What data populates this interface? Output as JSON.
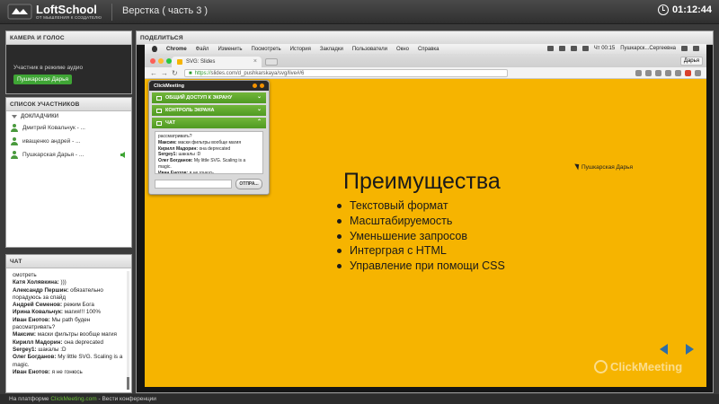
{
  "app": {
    "logo_name": "LoftSchool",
    "logo_tagline": "ОТ МЫШЛЕНИЯ К СОЗДАТЕЛЮ",
    "meeting_title": "Верстка ( часть 3 )",
    "timer": "01:12:44"
  },
  "camera_panel": {
    "title": "КАМЕРА И ГОЛОС",
    "audio_note": "Участник в режиме аудио",
    "speaker_name": "Пушкарская Дарья"
  },
  "users_panel": {
    "title": "СПИСОК УЧАСТНИКОВ",
    "group_label": "ДОКЛАДЧИКИ",
    "users": [
      {
        "name": "Дмитрий Ковальчук - ..."
      },
      {
        "name": "иващенко андрей - ..."
      },
      {
        "name": "Пушкарская Дарья - ..."
      }
    ]
  },
  "chat_panel": {
    "title": "ЧАТ",
    "messages": [
      {
        "author": "",
        "text": "смотреть"
      },
      {
        "author": "Катя Холявкина:",
        "text": ")))"
      },
      {
        "author": "Александр Першин:",
        "text": "обязательно порадуюсь за спайд"
      },
      {
        "author": "Андрей Семенов:",
        "text": "режим Бога"
      },
      {
        "author": "Ирина Ковальчук:",
        "text": "магия!!! 100%"
      },
      {
        "author": "Иван Енотов:",
        "text": "Мы path буден рассматривать?"
      },
      {
        "author": "Максим:",
        "text": "маски фильтры вообще магия"
      },
      {
        "author": "Кирилл Мадорин:",
        "text": "она deprecated"
      },
      {
        "author": "Sergey1:",
        "text": "шакалы :D"
      },
      {
        "author": "Олег Богданов:",
        "text": "My little SVG. Scaling is a magic."
      },
      {
        "author": "Иван Енотов:",
        "text": "я не гонюсь"
      }
    ]
  },
  "share_panel": {
    "title": "ПОДЕЛИТЬСЯ"
  },
  "mac_menu": {
    "items": [
      "Chrome",
      "Файл",
      "Изменить",
      "Посмотреть",
      "История",
      "Закладки",
      "Пользователи",
      "Окно",
      "Справка"
    ],
    "clock": "Чт 00:15",
    "user": "Пушкарск...Сергеевна"
  },
  "browser": {
    "tab_title": "SVG: Slides",
    "url_scheme": "https://",
    "url_rest": "slides.com/d_pushkarskaya/svg/live#/6",
    "user_button": "Дарья"
  },
  "slide": {
    "title": "Преимущества",
    "bullets": [
      "Текстовый формат",
      "Масштабируемость",
      "Уменьшение запросов",
      "Интерграя с HTML",
      "Управление при помощи CSS"
    ],
    "cursor_label": "Пушкарская Дарья",
    "watermark": "ClickMeeting"
  },
  "cm_widget": {
    "logo": "ClickMeeting",
    "rows": [
      {
        "label": "ОБЩИЙ ДОСТУП К ЭКРАНУ"
      },
      {
        "label": "КОНТРОЛЬ ЭКРАНА"
      },
      {
        "label": "ЧАТ"
      }
    ],
    "chat": [
      {
        "author": "",
        "text": "рассматривать?"
      },
      {
        "author": "Максим:",
        "text": "маски фильтры вообще магия"
      },
      {
        "author": "Кирилл Мадорин:",
        "text": "она deprecated"
      },
      {
        "author": "Sergey1:",
        "text": "шакалы :D"
      },
      {
        "author": "Олег Богданов:",
        "text": "My little SVG. Scaling is a magic."
      },
      {
        "author": "Иван Енотов:",
        "text": "я не гонюсь"
      }
    ],
    "send_label": "ОТПРА..."
  },
  "status": {
    "prefix": "На платформе",
    "link": "ClickMeeting.com",
    "suffix": "- Вести конференции"
  },
  "colors": {
    "slide_bg": "#f6b400",
    "accent_green": "#4f9a22",
    "nav_arrow": "#2c6da8"
  }
}
